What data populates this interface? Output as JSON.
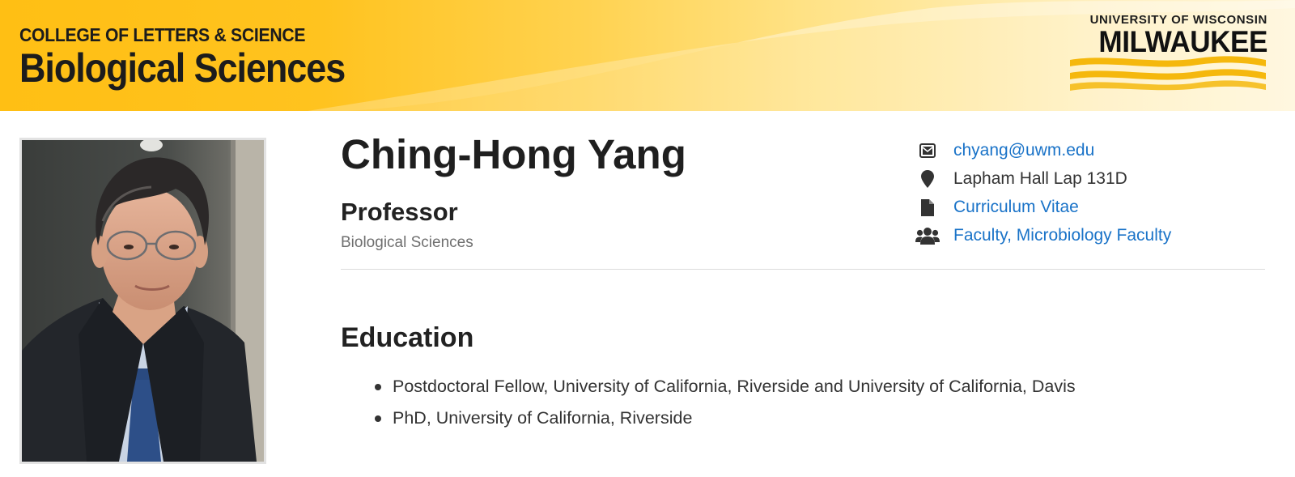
{
  "header": {
    "college": "COLLEGE OF LETTERS & SCIENCE",
    "department": "Biological Sciences",
    "logo": {
      "university": "UNIVERSITY OF WISCONSIN",
      "campus": "MILWAUKEE"
    },
    "colors": {
      "gold": "#ffbf14",
      "text": "#1c1c1c"
    }
  },
  "profile": {
    "name": "Ching-Hong Yang",
    "title": "Professor",
    "department": "Biological Sciences",
    "photo_alt": "Portrait of Ching-Hong Yang"
  },
  "contact": {
    "email": {
      "icon": "envelope-icon",
      "text": "chyang@uwm.edu"
    },
    "location": {
      "icon": "map-pin-icon",
      "text": "Lapham Hall Lap 131D"
    },
    "cv": {
      "icon": "document-icon",
      "text": "Curriculum Vitae"
    },
    "groups": {
      "icon": "users-icon",
      "text": "Faculty, Microbiology Faculty"
    },
    "link_color": "#1a73c8"
  },
  "education": {
    "heading": "Education",
    "items": [
      "Postdoctoral Fellow, University of California, Riverside and University of California, Davis",
      "PhD, University of California, Riverside"
    ]
  }
}
